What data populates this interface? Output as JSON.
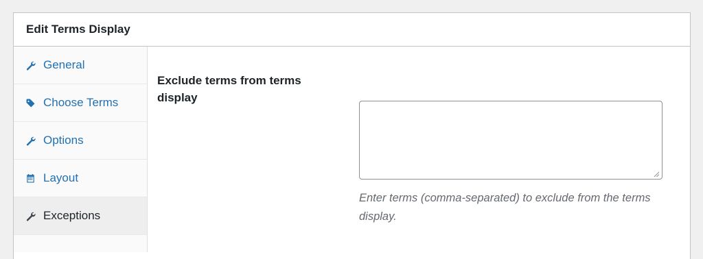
{
  "panel": {
    "title": "Edit Terms Display"
  },
  "tabs": [
    {
      "label": "General",
      "icon": "wrench-icon",
      "active": false
    },
    {
      "label": "Choose Terms",
      "icon": "tag-icon",
      "active": false
    },
    {
      "label": "Options",
      "icon": "wrench-icon",
      "active": false
    },
    {
      "label": "Layout",
      "icon": "calendar-icon",
      "active": false
    },
    {
      "label": "Exceptions",
      "icon": "wrench-icon",
      "active": true
    }
  ],
  "exceptions": {
    "field_label": "Exclude terms from terms display",
    "textarea_value": "",
    "description": "Enter terms (comma-separated) to exclude from the terms display."
  },
  "colors": {
    "link": "#2271b1",
    "text": "#1d2327",
    "muted": "#646970",
    "border": "#c3c4c7",
    "page_bg": "#f0f0f1"
  }
}
